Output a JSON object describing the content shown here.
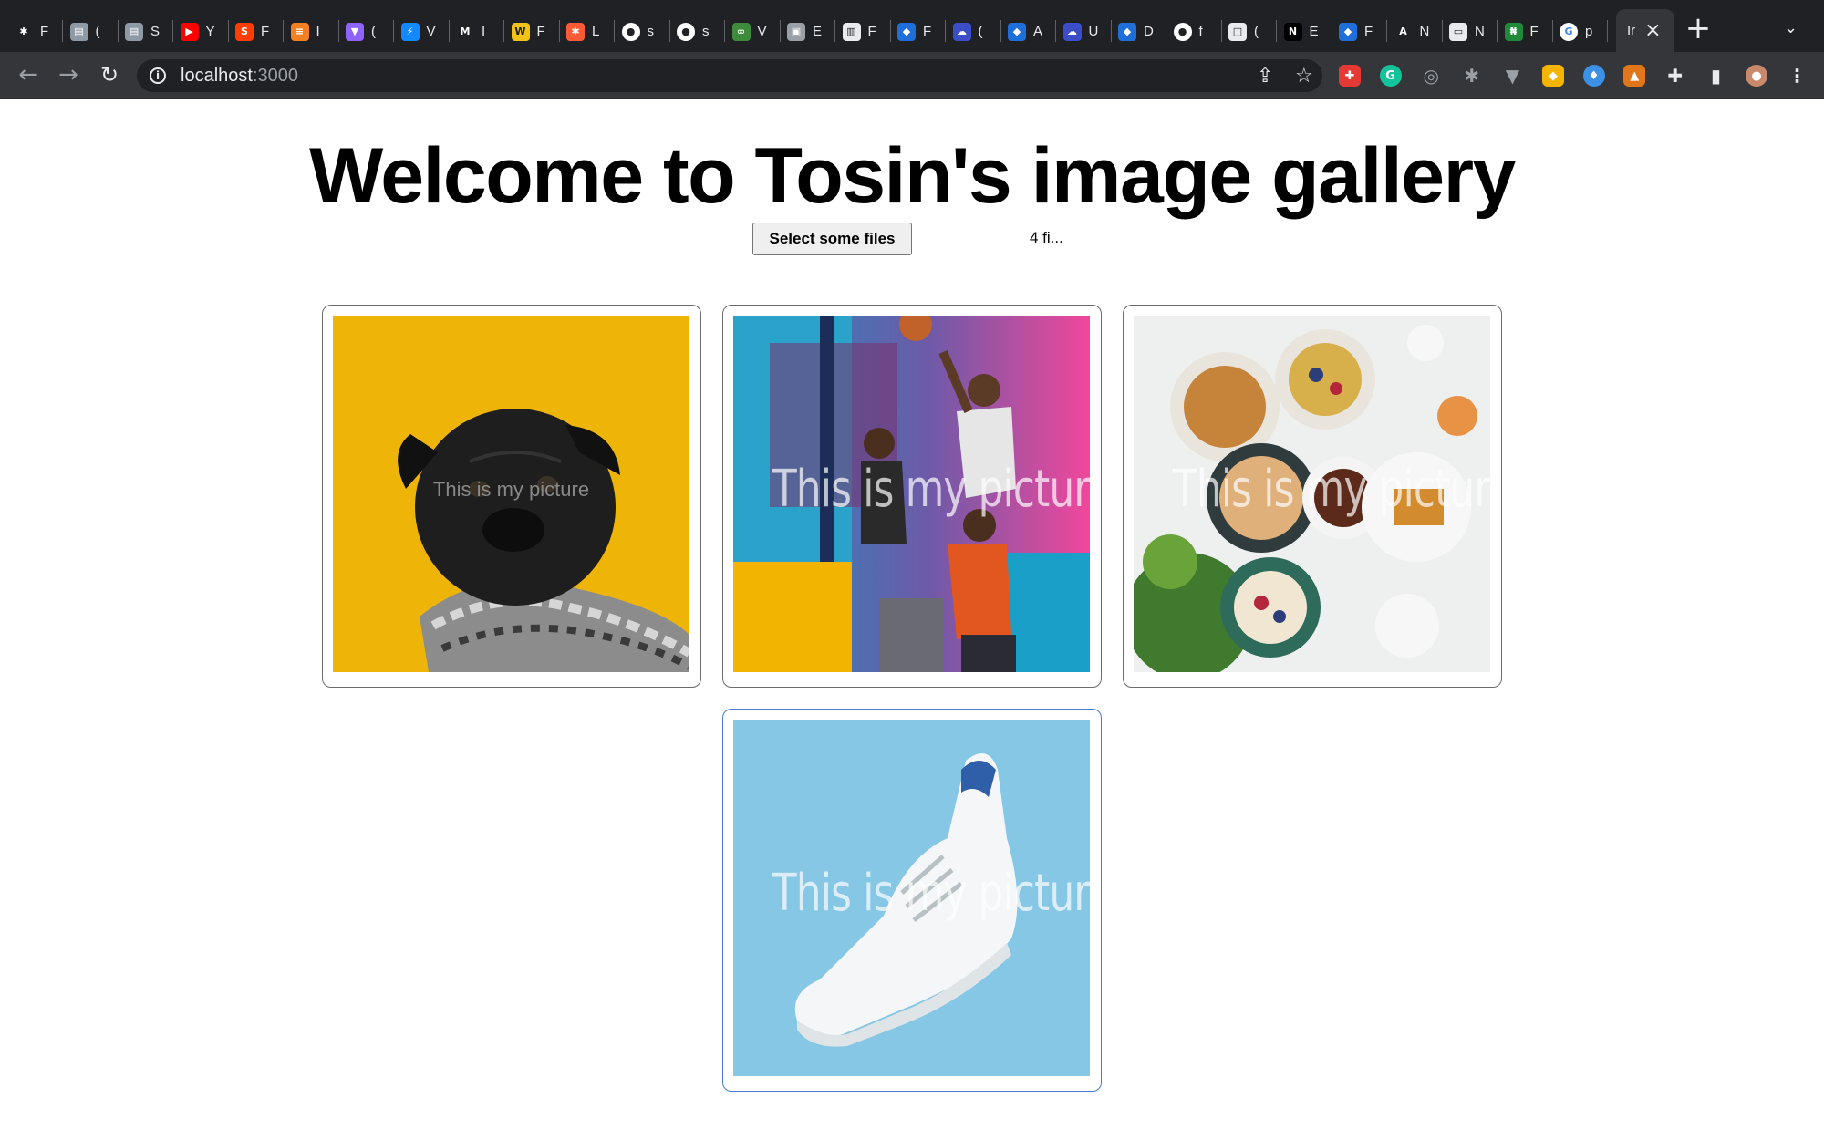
{
  "browser": {
    "tabs": [
      {
        "title": "F",
        "icon": "spider-icon",
        "color": "#202124"
      },
      {
        "title": "(",
        "icon": "sheet-icon",
        "color": "#8e9aa6"
      },
      {
        "title": "S",
        "icon": "sheet-icon",
        "color": "#8e9aa6"
      },
      {
        "title": "Y",
        "icon": "youtube-icon",
        "color": "#ff0000"
      },
      {
        "title": "F",
        "icon": "svelte-icon",
        "color": "#ff3e00"
      },
      {
        "title": "I",
        "icon": "stackoverflow-icon",
        "color": "#f48024"
      },
      {
        "title": "(",
        "icon": "vite-icon",
        "color": "#8f63ff"
      },
      {
        "title": "V",
        "icon": "bolt-icon",
        "color": "#1389fd"
      },
      {
        "title": "I",
        "icon": "m-icon",
        "color": "#202124"
      },
      {
        "title": "F",
        "icon": "ww-icon",
        "color": "#f2c314"
      },
      {
        "title": "L",
        "icon": "asterisk-icon",
        "color": "#ff5a36"
      },
      {
        "title": "s",
        "icon": "github-icon",
        "color": "#ffffff"
      },
      {
        "title": "s",
        "icon": "github-icon",
        "color": "#ffffff"
      },
      {
        "title": "V",
        "icon": "link-icon",
        "color": "#3c8c3c"
      },
      {
        "title": "E",
        "icon": "image-icon",
        "color": "#9aa0a6"
      },
      {
        "title": "F",
        "icon": "trello-icon",
        "color": "#e8eaed"
      },
      {
        "title": "F",
        "icon": "layers-icon",
        "color": "#1e6fd9"
      },
      {
        "title": "(",
        "icon": "cloud-icon",
        "color": "#3b4ec8"
      },
      {
        "title": "A",
        "icon": "layers-icon",
        "color": "#1e6fd9"
      },
      {
        "title": "U",
        "icon": "cloud-icon",
        "color": "#3b4ec8"
      },
      {
        "title": "D",
        "icon": "layers-icon",
        "color": "#1e6fd9"
      },
      {
        "title": "f",
        "icon": "github-icon",
        "color": "#ffffff"
      },
      {
        "title": "(",
        "icon": "square-icon",
        "color": "#e8eaed"
      },
      {
        "title": "E",
        "icon": "n-icon",
        "color": "#000000"
      },
      {
        "title": "F",
        "icon": "layers-icon",
        "color": "#1e6fd9"
      },
      {
        "title": "N",
        "icon": "a-icon",
        "color": "#202124"
      },
      {
        "title": "N",
        "icon": "window-icon",
        "color": "#e8eaed"
      },
      {
        "title": "F",
        "icon": "naira-icon",
        "color": "#1f8a3a"
      },
      {
        "title": "p",
        "icon": "google-icon",
        "color": "#ffffff"
      }
    ],
    "active_tab": {
      "title": "Ir",
      "close": "×"
    },
    "new_tab": "+",
    "tab_menu": "⌄",
    "address": {
      "host": "localhost",
      "port": ":3000"
    },
    "extensions": [
      {
        "icon": "puzzle-red-icon",
        "color": "#e53935"
      },
      {
        "icon": "grammarly-icon",
        "color": "#15c39a"
      },
      {
        "icon": "target-icon",
        "color": "#9aa0a6"
      },
      {
        "icon": "bug-icon",
        "color": "#9aa0a6"
      },
      {
        "icon": "shield-icon",
        "color": "#9aa0a6"
      },
      {
        "icon": "color-picker-icon",
        "color": "#f4b400"
      },
      {
        "icon": "ethereum-icon",
        "color": "#3c91e6"
      },
      {
        "icon": "metamask-icon",
        "color": "#e2761b"
      },
      {
        "icon": "extensions-icon",
        "color": "#e8eaed"
      },
      {
        "icon": "sidebar-icon",
        "color": "#e8eaed"
      },
      {
        "icon": "profile-avatar-icon",
        "color": "#c98a6b"
      },
      {
        "icon": "kebab-menu-icon",
        "color": "#e8eaed"
      }
    ]
  },
  "page": {
    "title": "Welcome to Tosin's image gallery",
    "file_button": "Select some files",
    "file_count": "4 fi..."
  },
  "gallery": [
    {
      "caption": "This is my picture",
      "subject": "pug in scarf on yellow",
      "bg": "#eeb508",
      "selected": false
    },
    {
      "caption": "This is my picture",
      "subject": "basketball players",
      "bg": "#2fa6c9",
      "selected": false
    },
    {
      "caption": "This is my picture",
      "subject": "breakfast spread",
      "bg": "#eef0f0",
      "selected": false
    },
    {
      "caption": "This is my picture",
      "subject": "white sneaker on blue",
      "bg": "#86c7e5",
      "selected": true
    }
  ]
}
